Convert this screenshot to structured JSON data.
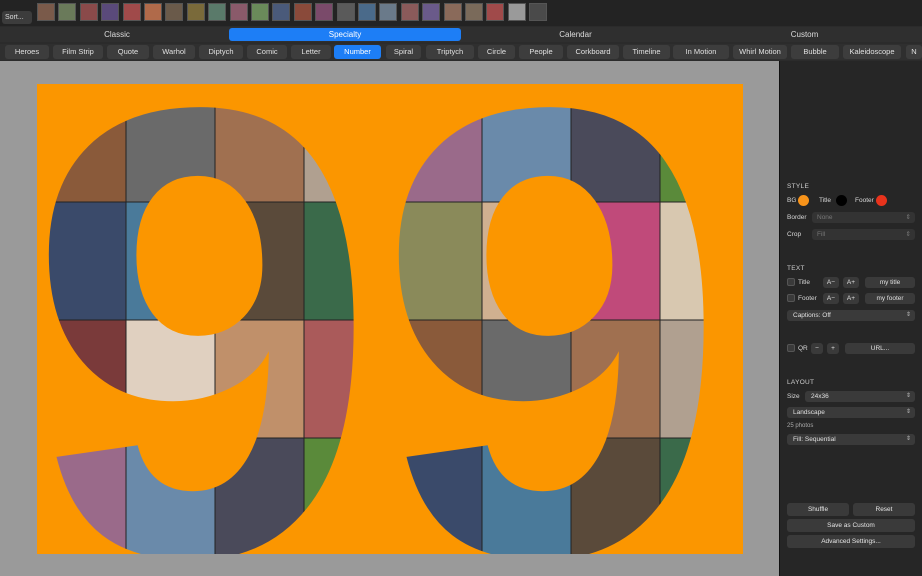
{
  "toolbar": {
    "sort_label": "Sort..."
  },
  "photo_strip": {
    "thumbs": [
      "#7a5a4a",
      "#6a7a5a",
      "#8a4a4a",
      "#5a4a7a",
      "#a04a4a",
      "#b06a4a",
      "#6a5a4a",
      "#7a6a3a",
      "#5a7a6a",
      "#8a5a6a",
      "#6a8a5a",
      "#4a5a7a",
      "#8a4a3a",
      "#7a4a6a",
      "#5a5a5a",
      "#4a6a8a",
      "#6a7a8a",
      "#8a5a5a",
      "#6a5a8a",
      "#8a6a5a",
      "#7a6a5a",
      "#a04a4a",
      "#9a9a9a",
      "#4a4a4a"
    ]
  },
  "categories": [
    {
      "label": "Classic",
      "active": false
    },
    {
      "label": "Specialty",
      "active": true
    },
    {
      "label": "Calendar",
      "active": false
    },
    {
      "label": "Custom",
      "active": false
    }
  ],
  "layouts": [
    {
      "label": "Heroes",
      "active": false
    },
    {
      "label": "Film Strip",
      "active": false
    },
    {
      "label": "Quote",
      "active": false
    },
    {
      "label": "Warhol",
      "active": false
    },
    {
      "label": "Diptych",
      "active": false
    },
    {
      "label": "Comic",
      "active": false
    },
    {
      "label": "Letter",
      "active": false
    },
    {
      "label": "Number",
      "active": true
    },
    {
      "label": "Spiral",
      "active": false
    },
    {
      "label": "Triptych",
      "active": false
    },
    {
      "label": "Circle",
      "active": false
    },
    {
      "label": "People",
      "active": false
    },
    {
      "label": "Corkboard",
      "active": false
    },
    {
      "label": "Timeline",
      "active": false
    },
    {
      "label": "In Motion",
      "active": false
    },
    {
      "label": "Whirl Motion",
      "active": false
    },
    {
      "label": "Bubble",
      "active": false
    },
    {
      "label": "Kaleidoscope",
      "active": false
    },
    {
      "label": "N",
      "active": false
    }
  ],
  "canvas": {
    "number": "99",
    "bg_color": "#fb9600"
  },
  "style": {
    "heading": "STYLE",
    "bg_label": "BG",
    "bg_color": "#f7931a",
    "title_label": "Title",
    "title_color": "#000000",
    "footer_label": "Footer",
    "footer_color": "#e8331c",
    "border_label": "Border",
    "border_value": "None",
    "crop_label": "Crop",
    "crop_value": "Fill"
  },
  "text": {
    "heading": "TEXT",
    "title_label": "Title",
    "title_value": "my title",
    "footer_label": "Footer",
    "footer_value": "my footer",
    "decrease_label": "A−",
    "increase_label": "A+",
    "captions": "Captions: Off",
    "qr_label": "QR",
    "qr_minus": "−",
    "qr_plus": "+",
    "url_button": "URL..."
  },
  "layout": {
    "heading": "LAYOUT",
    "size_label": "Size",
    "size_value": "24x36",
    "orientation": "Landscape",
    "photo_count": "25 photos",
    "fill_mode": "Fill: Sequential"
  },
  "actions": {
    "shuffle": "Shuffle",
    "reset": "Reset",
    "save_custom": "Save as Custom",
    "advanced": "Advanced Settings..."
  }
}
